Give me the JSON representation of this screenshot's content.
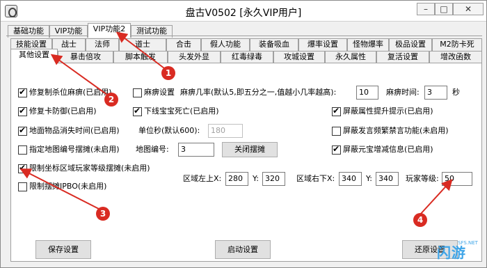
{
  "window": {
    "title": "盘古V0502 [永久VIP用户]",
    "min_glyph": "–",
    "max_glyph": "□",
    "close_glyph": "✕"
  },
  "tabs_row1": [
    "基础功能",
    "VIP功能",
    "VIP功能2",
    "测试功能"
  ],
  "tabs_row2": [
    "技能设置",
    "战士",
    "法师",
    "道士",
    "合击",
    "假人功能",
    "装备吸血",
    "爆率设置",
    "怪物爆率",
    "极品设置",
    "M2防卡死"
  ],
  "tabs_row3": [
    "其他设置",
    "暴击倍攻",
    "脚本触发",
    "头发外显",
    "红毒绿毒",
    "攻城设置",
    "永久属性",
    "复活设置",
    "增改函数"
  ],
  "options": {
    "fix_kill_paralysis": {
      "label": "修复制杀位麻痹(已启用)",
      "checked": true
    },
    "fix_lag_defense": {
      "label": "修复卡防御(已启用)",
      "checked": true
    },
    "ground_items_vanish": {
      "label": "地面物品消失时间(已启用)",
      "checked": true
    },
    "map_number_stall": {
      "label": "指定地图编号摆摊(未启用)",
      "checked": false
    },
    "limit_area_level_stall": {
      "label": "限制坐标区域玩家等级摆摊(未启用)",
      "checked": true
    },
    "limit_stall_ipbo": {
      "label": "限制摆摊IPBO(未启用)",
      "checked": false
    },
    "paralysis_settings": {
      "label": "麻痹设置",
      "checked": false
    },
    "offline_pet_death": {
      "label": "下线宝宝死亡(已启用)",
      "checked": true
    },
    "block_attr_hint": {
      "label": "屏蔽属性提升提示(已启用)",
      "checked": true
    },
    "block_speech_freq": {
      "label": "屏蔽发言频繁禁言功能(未启用)",
      "checked": false
    },
    "block_yuanbao_info": {
      "label": "屏蔽元宝增减信息(已启用)",
      "checked": true
    }
  },
  "fields": {
    "paralysis_rate_label": "麻痹几率(默认5,即五分之一,值越小几率越高):",
    "paralysis_rate": "10",
    "paralysis_time_label": "麻痹时间:",
    "paralysis_time": "3",
    "seconds_unit": "秒",
    "unit_seconds_label": "单位秒(默认600):",
    "unit_seconds": "180",
    "map_number_label": "地图编号:",
    "map_number": "3",
    "close_stall_button": "关闭摆摊",
    "area_top_left_label": "区域左上X:",
    "area_top_left_x": "280",
    "y_label_1": "Y:",
    "area_top_left_y": "320",
    "area_bottom_right_label": "区域右下X:",
    "area_bottom_right_x": "340",
    "y_label_2": "Y:",
    "area_bottom_right_y": "340",
    "player_level_label": "玩家等级:",
    "player_level": "50"
  },
  "buttons": {
    "save": "保存设置",
    "start": "启动设置",
    "restore": "还原设置"
  },
  "markers": [
    "1",
    "2",
    "3",
    "4"
  ],
  "watermark": {
    "text": "闪游",
    "site": "SFS.NET"
  },
  "colors": {
    "marker": "#d92b22",
    "watermark": "#3fa5e8"
  }
}
